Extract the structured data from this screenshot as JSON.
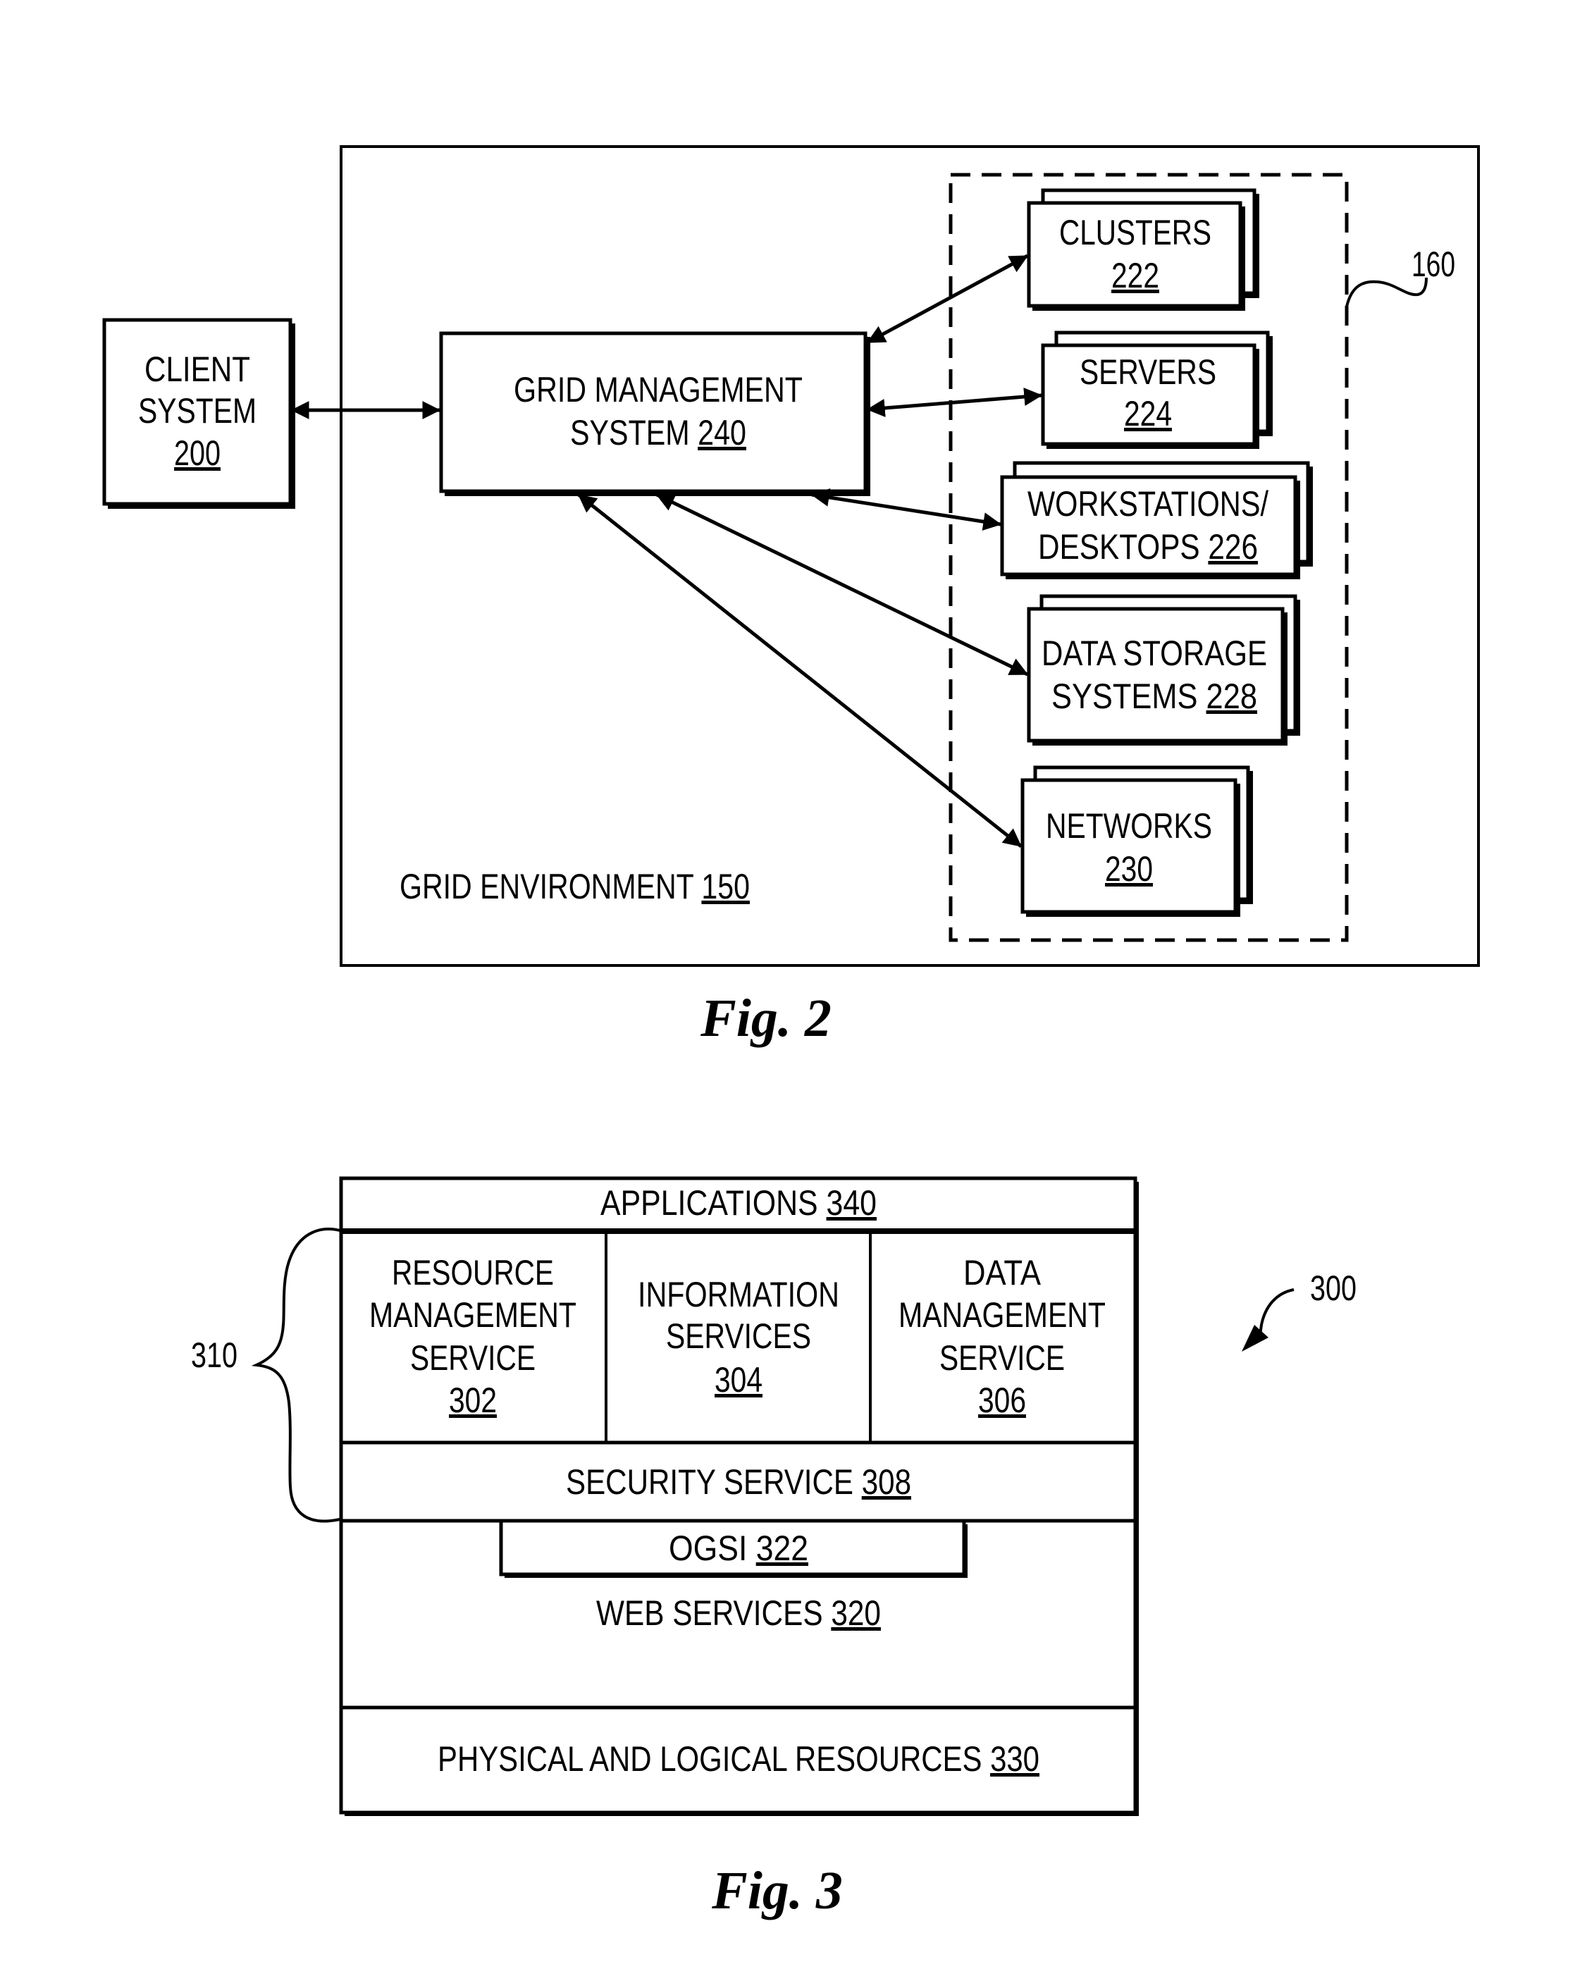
{
  "fig2": {
    "caption": "Fig. 2",
    "client": {
      "line1": "CLIENT",
      "line2": "SYSTEM",
      "ref": "200"
    },
    "gms": {
      "line1": "GRID MANAGEMENT",
      "line2": "SYSTEM ",
      "ref": "240"
    },
    "environment": {
      "label": "GRID ENVIRONMENT ",
      "ref": "150"
    },
    "resource_group_ref": "160",
    "resources": [
      {
        "line1": "CLUSTERS",
        "line2": "",
        "ref": "222"
      },
      {
        "line1": "SERVERS",
        "line2": "",
        "ref": "224"
      },
      {
        "line1": "WORKSTATIONS/",
        "line2": "DESKTOPS  ",
        "ref": "226"
      },
      {
        "line1": "DATA STORAGE",
        "line2": "SYSTEMS  ",
        "ref": "228"
      },
      {
        "line1": "NETWORKS",
        "line2": "",
        "ref": "230"
      }
    ]
  },
  "fig3": {
    "caption": "Fig. 3",
    "diagram_ref": "300",
    "brace_ref": "310",
    "applications": {
      "label": "APPLICATIONS  ",
      "ref": "340"
    },
    "resource_mgmt": {
      "line1": "RESOURCE",
      "line2": "MANAGEMENT",
      "line3": "SERVICE",
      "ref": "302"
    },
    "information": {
      "line1": "INFORMATION",
      "line2": "SERVICES",
      "ref": "304"
    },
    "data_mgmt": {
      "line1": "DATA",
      "line2": "MANAGEMENT",
      "line3": "SERVICE",
      "ref": "306"
    },
    "security": {
      "label": "SECURITY SERVICE  ",
      "ref": "308"
    },
    "ogsi": {
      "label": "OGSI  ",
      "ref": "322"
    },
    "web_services": {
      "label": "WEB SERVICES  ",
      "ref": "320"
    },
    "physical": {
      "label": "PHYSICAL AND LOGICAL RESOURCES  ",
      "ref": "330"
    }
  }
}
